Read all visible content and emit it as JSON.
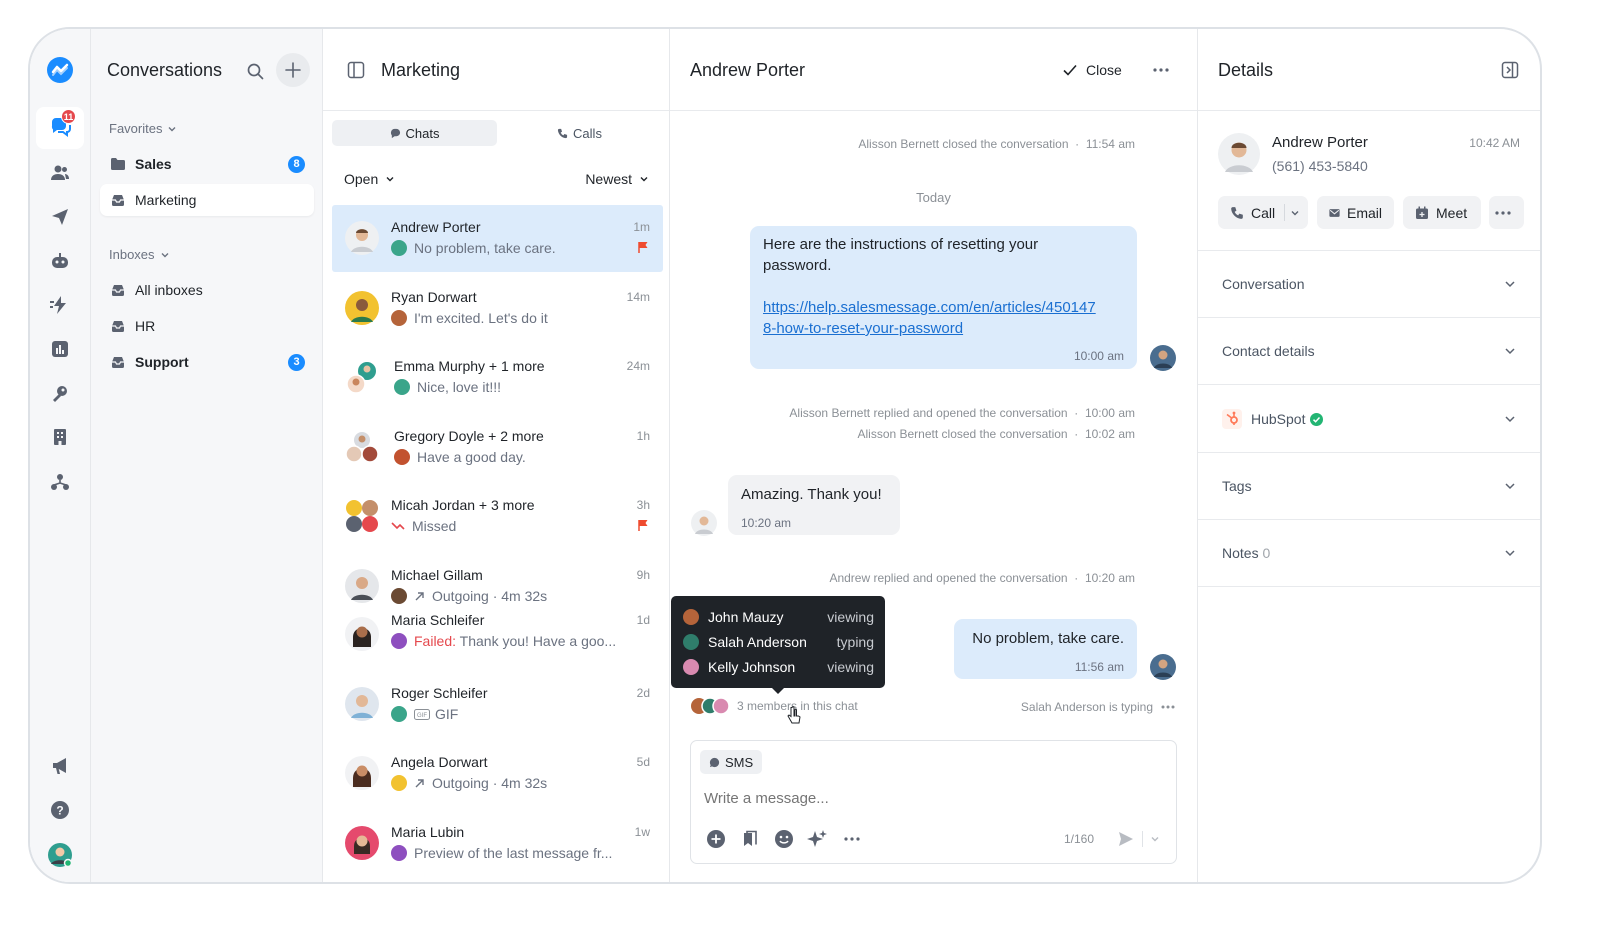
{
  "rail": {
    "notification_count": "11",
    "items": [
      "conversations-icon",
      "contacts-icon",
      "broadcasts-icon",
      "automations-icon",
      "flows-icon",
      "reports-icon",
      "integrations-icon",
      "organization-icon",
      "teams-icon"
    ],
    "bottom": [
      "announcements-icon",
      "help-icon",
      "user-avatar"
    ]
  },
  "nav": {
    "title": "Conversations",
    "favorites_label": "Favorites",
    "favorites": [
      {
        "label": "Sales",
        "badge": "8",
        "bold": true
      },
      {
        "label": "Marketing",
        "active": true
      }
    ],
    "inboxes_label": "Inboxes",
    "inboxes": [
      {
        "label": "All inboxes"
      },
      {
        "label": "HR"
      },
      {
        "label": "Support",
        "badge": "3",
        "bold": true
      }
    ]
  },
  "list": {
    "title": "Marketing",
    "tabs": [
      {
        "label": "Chats",
        "selected": true
      },
      {
        "label": "Calls"
      }
    ],
    "filter": "Open",
    "sort": "Newest",
    "items": [
      {
        "name": "Andrew Porter",
        "preview": "No problem, take care.",
        "time": "1m",
        "flag": true,
        "selected": true
      },
      {
        "name": "Ryan Dorwart",
        "preview": "I'm excited. Let's do it",
        "time": "14m"
      },
      {
        "name": "Emma Murphy + 1 more",
        "preview": "Nice, love it!!!",
        "time": "24m"
      },
      {
        "name": "Gregory Doyle + 2 more",
        "preview": "Have a good day.",
        "time": "1h"
      },
      {
        "name": "Micah Jordan + 3 more",
        "preview": "Missed",
        "time": "3h",
        "flag": true
      },
      {
        "name": "Michael Gillam",
        "preview": "Outgoing · 4m 32s",
        "time": "9h"
      },
      {
        "name": "Maria Schleifer",
        "preview_prefix": "Failed:",
        "preview": " Thank you! Have a goo...",
        "time": "1d"
      },
      {
        "name": "Roger Schleifer",
        "preview": "GIF",
        "time": "2d"
      },
      {
        "name": "Angela Dorwart",
        "preview": "Outgoing · 4m 32s",
        "time": "5d"
      },
      {
        "name": "Maria Lubin",
        "preview": "Preview of the last message fr...",
        "time": "1w"
      }
    ]
  },
  "chat": {
    "contact": "Andrew Porter",
    "close_label": "Close",
    "events": {
      "e1_text": "Alisson Bernett closed the conversation",
      "e1_time": "11:54 am",
      "today": "Today",
      "e2_text": "Alisson Bernett replied and opened the conversation",
      "e2_time": "10:00 am",
      "e3_text": "Alisson Bernett closed the conversation",
      "e3_time": "10:02 am",
      "e4_text": "Andrew replied and opened the conversation",
      "e4_time": "10:20 am"
    },
    "msg1": {
      "text": "Here are the instructions of resetting your password.",
      "link": "https://help.salesmessage.com/en/articles/4501478-how-to-reset-your-password",
      "link_line1": "https://help.salesmessage.com/en/articles/450147",
      "link_line2": "8-how-to-reset-your-password",
      "time": "10:00 am"
    },
    "msg2": {
      "text": "Amazing. Thank you!",
      "time": "10:20 am"
    },
    "msg3": {
      "text": "No problem, take care.",
      "time": "11:56 am"
    },
    "members_label": "3 members in this chat",
    "typing_label": "Salah Anderson is typing",
    "members_popup": [
      {
        "name": "John Mauzy",
        "status": "viewing"
      },
      {
        "name": "Salah Anderson",
        "status": "typing"
      },
      {
        "name": "Kelly Johnson",
        "status": "viewing"
      }
    ],
    "composer": {
      "channel": "SMS",
      "placeholder": "Write a message...",
      "counter": "1/160"
    }
  },
  "details": {
    "title": "Details",
    "contact_name": "Andrew Porter",
    "phone": "(561) 453-5840",
    "time": "10:42 AM",
    "buttons": {
      "call": "Call",
      "email": "Email",
      "meet": "Meet"
    },
    "sections": [
      {
        "label": "Conversation"
      },
      {
        "label": "Contact details"
      },
      {
        "label": "HubSpot"
      },
      {
        "label": "Tags"
      },
      {
        "label": "Notes",
        "count": "0"
      }
    ]
  },
  "colors": {
    "accent": "#1a8cff",
    "selected_bg": "#dcebfb",
    "flag": "#ef4b2f",
    "failed": "#e5484d",
    "hubspot": "#ff7a59",
    "verified": "#22b573"
  }
}
